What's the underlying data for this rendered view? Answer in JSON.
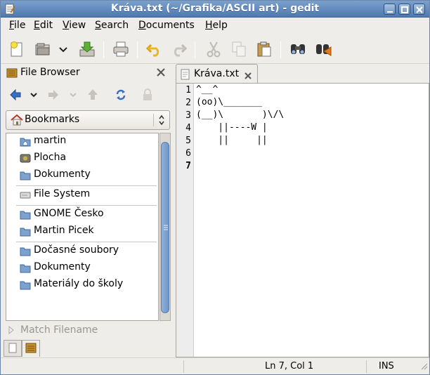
{
  "window": {
    "title": "Kráva.txt (~/Grafika/ASCII art) - gedit"
  },
  "menubar": [
    {
      "underline": "F",
      "rest": "ile"
    },
    {
      "underline": "E",
      "rest": "dit"
    },
    {
      "underline": "V",
      "rest": "iew"
    },
    {
      "underline": "S",
      "rest": "earch"
    },
    {
      "underline": "D",
      "rest": "ocuments"
    },
    {
      "underline": "H",
      "rest": "elp"
    }
  ],
  "side_panel": {
    "title": "File Browser",
    "bookmarks_label": "Bookmarks",
    "match_filename": "Match Filename",
    "tree": [
      {
        "label": "martin",
        "icon": "home-folder-icon"
      },
      {
        "label": "Plocha",
        "icon": "desktop-icon"
      },
      {
        "label": "Dokumenty",
        "icon": "folder-icon"
      },
      {
        "label": "File System",
        "icon": "drive-icon"
      },
      {
        "label": "GNOME Česko",
        "icon": "folder-icon"
      },
      {
        "label": "Martin Picek",
        "icon": "folder-icon"
      },
      {
        "label": "Dočasné soubory",
        "icon": "folder-icon"
      },
      {
        "label": "Dokumenty",
        "icon": "folder-icon"
      },
      {
        "label": "Materiály do školy",
        "icon": "folder-icon"
      }
    ]
  },
  "document": {
    "tab_label": "Kráva.txt",
    "line_numbers": [
      "1",
      "2",
      "3",
      "4",
      "5",
      "6",
      "7"
    ],
    "lines": [
      "^__^",
      "(oo)\\_______",
      "(__)\\       )\\/\\",
      "    ||----W |",
      "    ||     ||",
      "",
      ""
    ]
  },
  "statusbar": {
    "position": "Ln 7, Col 1",
    "mode": "INS"
  },
  "colors": {
    "titlebar": "#5f87bb",
    "folder": "#7da2d0",
    "selection_thumb": "#7aa0d0"
  }
}
